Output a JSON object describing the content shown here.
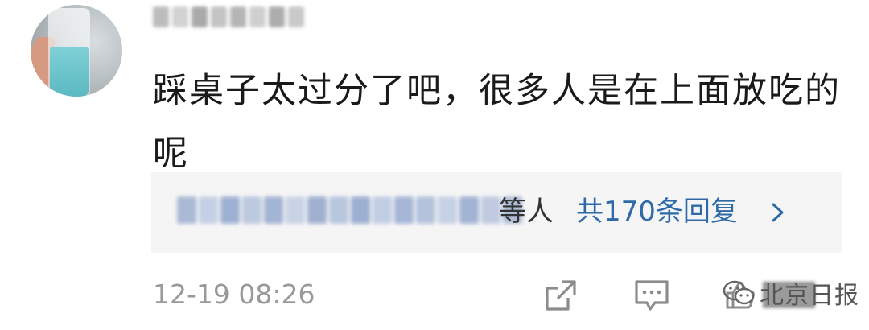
{
  "comment": {
    "username": "██████",
    "username_blocks": [
      "#bdbdbd",
      "#d2d2d2",
      "#a9a9a9",
      "#c4c4c4",
      "#b5b5b5",
      "#cfcfcf",
      "#adadad",
      "#c9c9c9"
    ],
    "text": "踩桌子太过分了吧，很多人是在上面放吃的呢",
    "timestamp": "12-19 08:26"
  },
  "replies": {
    "name_blocks": [
      "#aab9d6",
      "#c5d0e4",
      "#9fb1d3",
      "#bcc9e0",
      "#a4b4d4",
      "#c9d3e6",
      "#a0b0d0",
      "#b8c6de",
      "#9eb0d2",
      "#c1cde3",
      "#a6b6d5",
      "#b4c2dc",
      "#c7d1e5",
      "#a2b3d3",
      "#bfcae0",
      "#aebcd8"
    ],
    "suffix": "等人",
    "count_label": "共170条回复"
  },
  "actions": {
    "share_icon": "share-icon",
    "reply_icon": "reply-icon",
    "like_icon": "like-icon",
    "like_count": "███"
  },
  "watermark": {
    "text": "北京日报"
  },
  "colors": {
    "link": "#2f6aa8",
    "muted": "#9a9a9a",
    "reply_bg": "#f5f5f5"
  }
}
